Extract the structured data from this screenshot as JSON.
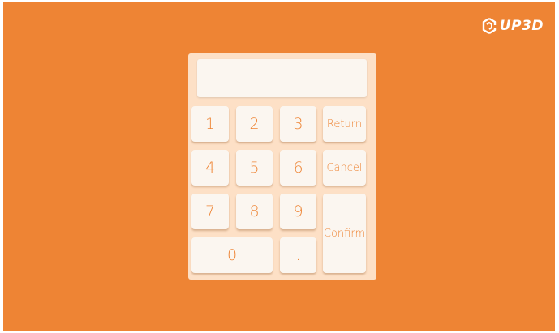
{
  "brand": {
    "logo_text": "UP3D"
  },
  "keypad": {
    "display_value": "",
    "keys": {
      "k1": "1",
      "k2": "2",
      "k3": "3",
      "k4": "4",
      "k5": "5",
      "k6": "6",
      "k7": "7",
      "k8": "8",
      "k9": "9",
      "k0": "0",
      "dot": ".",
      "return": "Return",
      "cancel": "Cancel",
      "confirm": "Confirm"
    }
  },
  "colors": {
    "background": "#ee8434",
    "panel": "#fde0c6",
    "key": "#fbf6f0",
    "key_text": "#ee8434"
  }
}
